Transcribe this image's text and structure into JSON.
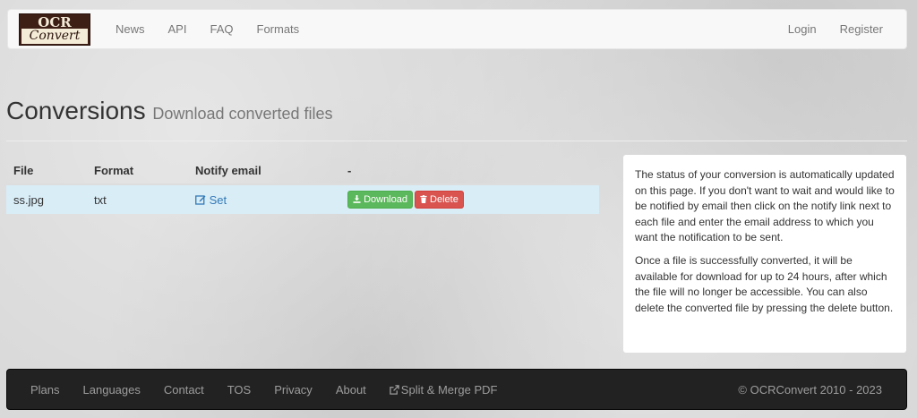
{
  "navbar": {
    "logo_top": "OCR",
    "logo_bottom": "Convert",
    "left_links": [
      "News",
      "API",
      "FAQ",
      "Formats"
    ],
    "right_links": [
      "Login",
      "Register"
    ]
  },
  "header": {
    "title": "Conversions",
    "subtitle": "Download converted files"
  },
  "table": {
    "columns": [
      "File",
      "Format",
      "Notify email",
      "-"
    ],
    "rows": [
      {
        "file": "ss.jpg",
        "format": "txt",
        "notify_label": "Set",
        "download_label": "Download",
        "delete_label": "Delete"
      }
    ]
  },
  "info": {
    "p1": "The status of your conversion is automatically updated on this page. If you don't want to wait and would like to be notified by email then click on the notify link next to each file and enter the email address to which you want the notification to be sent.",
    "p2": "Once a file is successfully converted, it will be available for download for up to 24 hours, after which the file will no longer be accessible. You can also delete the converted file by pressing the delete button."
  },
  "footer": {
    "links": [
      "Plans",
      "Languages",
      "Contact",
      "TOS",
      "Privacy",
      "About",
      "Split & Merge PDF"
    ],
    "copyright": "© OCRConvert 2010 - 2023"
  },
  "icons": {
    "edit": "edit-icon",
    "download": "download-icon",
    "trash": "trash-icon",
    "external": "external-link-icon"
  },
  "colors": {
    "info_row": "#d9edf7",
    "success": "#5cb85c",
    "danger": "#d9534f",
    "link": "#337ab7",
    "footer_bg": "#222222"
  }
}
